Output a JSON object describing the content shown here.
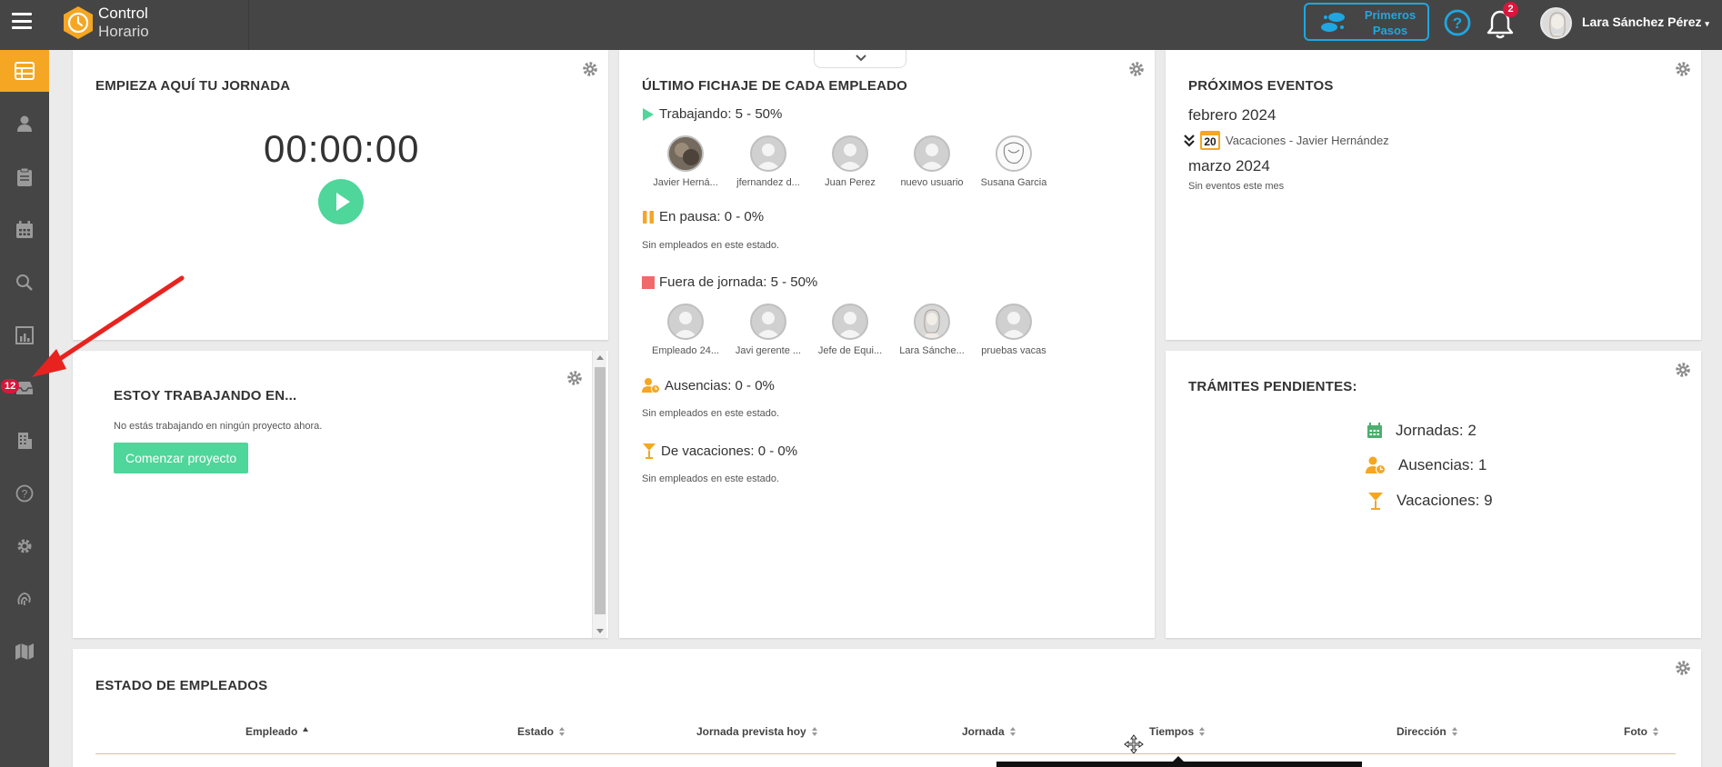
{
  "app": {
    "logo_line1": "Control",
    "logo_line2": "Horario",
    "accent_color": "#f5a623",
    "green_color": "#4fd69a",
    "blue_color": "#1ea7e1"
  },
  "topbar": {
    "primeros_line1": "Primeros",
    "primeros_line2": "Pasos",
    "notifications_count": "2",
    "user_name": "Lara Sánchez Pérez"
  },
  "sidebar": {
    "badge_count": "12",
    "items": [
      {
        "icon": "dashboard-icon"
      },
      {
        "icon": "person-icon"
      },
      {
        "icon": "clipboard-icon"
      },
      {
        "icon": "calendar-icon"
      },
      {
        "icon": "search-icon"
      },
      {
        "icon": "report-icon"
      },
      {
        "icon": "inbox-icon"
      },
      {
        "icon": "building-icon"
      },
      {
        "icon": "help-icon"
      },
      {
        "icon": "settings-icon"
      },
      {
        "icon": "fingerprint-icon"
      },
      {
        "icon": "map-icon"
      }
    ]
  },
  "jornada": {
    "title": "EMPIEZA AQUÍ TU JORNADA",
    "timer": "00:00:00"
  },
  "proyecto": {
    "title": "ESTOY TRABAJANDO EN...",
    "text": "No estás trabajando en ningún proyecto ahora.",
    "button": "Comenzar proyecto"
  },
  "fichaje": {
    "title": "ÚLTIMO FICHAJE DE CADA EMPLEADO",
    "trabajando": {
      "label": "Trabajando: 5 - 50%",
      "employees": [
        "Javier Herná...",
        "jfernandez d...",
        "Juan Perez",
        "nuevo usuario",
        "Susana Garcia"
      ]
    },
    "pausa": {
      "label": "En pausa: 0 - 0%",
      "empty": "Sin empleados en este estado."
    },
    "fuera": {
      "label": "Fuera de jornada: 5 - 50%",
      "employees": [
        "Empleado 24...",
        "Javi gerente ...",
        "Jefe de Equi...",
        "Lara Sánche...",
        "pruebas vacas"
      ]
    },
    "ausencias": {
      "label": "Ausencias: 0 - 0%",
      "empty": "Sin empleados en este estado."
    },
    "vacaciones": {
      "label": "De vacaciones: 0 - 0%",
      "empty": "Sin empleados en este estado."
    }
  },
  "eventos": {
    "title": "PRÓXIMOS EVENTOS",
    "month1": "febrero 2024",
    "event_day": "20",
    "event_text": "Vacaciones - Javier Hernández",
    "month2": "marzo 2024",
    "month2_empty": "Sin eventos este mes"
  },
  "tramites": {
    "title": "TRÁMITES PENDIENTES:",
    "items": [
      {
        "label": "Jornadas: 2",
        "icon": "calendar-icon"
      },
      {
        "label": "Ausencias: 1",
        "icon": "person-clock-icon"
      },
      {
        "label": "Vacaciones: 9",
        "icon": "cocktail-icon"
      }
    ]
  },
  "estado": {
    "title": "ESTADO DE EMPLEADOS",
    "columns": [
      "Empleado",
      "Estado",
      "Jornada prevista hoy",
      "Jornada",
      "Tiempos",
      "Dirección",
      "Foto"
    ]
  }
}
